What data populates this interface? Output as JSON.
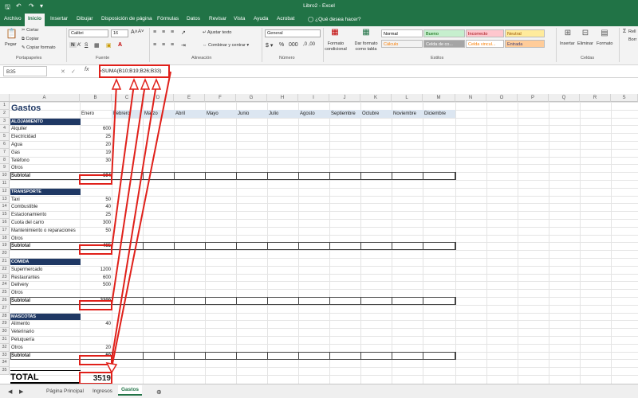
{
  "window": {
    "title": "Libro2 - Excel"
  },
  "ribbon_tabs": [
    "Archivo",
    "Inicio",
    "Insertar",
    "Dibujar",
    "Disposición de página",
    "Fórmulas",
    "Datos",
    "Revisar",
    "Vista",
    "Ayuda",
    "Acrobat"
  ],
  "active_tab": "Inicio",
  "tell_me": "¿Qué desea hacer?",
  "clipboard": {
    "paste": "Pegar",
    "cut": "Cortar",
    "copy": "Copiar",
    "format_painter": "Copiar formato",
    "label": "Portapapeles"
  },
  "font": {
    "name": "Calibri",
    "size": "16",
    "label": "Fuente",
    "bold": "N",
    "italic": "K",
    "underline": "S"
  },
  "alignment": {
    "wrap": "Ajustar texto",
    "merge": "Combinar y centrar",
    "label": "Alineación"
  },
  "number": {
    "format": "General",
    "label": "Número"
  },
  "styles": {
    "cond_format": "Formato condicional",
    "table_format": "Dar formato como tabla",
    "label": "Estilos",
    "cells": [
      {
        "text": "Normal",
        "bg": "#ffffff",
        "fg": "#000000"
      },
      {
        "text": "Bueno",
        "bg": "#c6efce",
        "fg": "#006100"
      },
      {
        "text": "Incorrecto",
        "bg": "#ffc7ce",
        "fg": "#9c0006"
      },
      {
        "text": "Neutral",
        "bg": "#ffeb9c",
        "fg": "#9c5700"
      },
      {
        "text": "Cálculo",
        "bg": "#f2f2f2",
        "fg": "#fa7d00"
      },
      {
        "text": "Celda de co...",
        "bg": "#a5a5a5",
        "fg": "#ffffff"
      },
      {
        "text": "Celda vincul...",
        "bg": "#ffffff",
        "fg": "#fa7d00"
      },
      {
        "text": "Entrada",
        "bg": "#ffcc99",
        "fg": "#3f3f76"
      }
    ]
  },
  "cells_group": {
    "insert": "Insertar",
    "delete": "Eliminar",
    "format": "Formato",
    "label": "Celdas"
  },
  "editing": {
    "sum": "Σ",
    "fill": "Rell",
    "clear": "Borr"
  },
  "name_box": "B35",
  "formula": "=SUMA(B10;B19;B26;B33)",
  "columns": [
    "A",
    "B",
    "C",
    "D",
    "E",
    "F",
    "G",
    "H",
    "I",
    "J",
    "K",
    "L",
    "M",
    "N",
    "O",
    "P",
    "Q",
    "R",
    "S"
  ],
  "months": [
    "Enero",
    "Febrero",
    "Marzo",
    "Abril",
    "Mayo",
    "Junio",
    "Julio",
    "Agosto",
    "Septiembre",
    "Octubre",
    "Noviembre",
    "Diciembre"
  ],
  "title": "Gastos",
  "sections": [
    {
      "header": "ALOJAMIENTO",
      "items": [
        [
          "Alquiler",
          "600"
        ],
        [
          "Electricidad",
          "25"
        ],
        [
          "Agua",
          "20"
        ],
        [
          "Gas",
          "19"
        ],
        [
          "Teléfono",
          "30"
        ],
        [
          "Otros",
          ""
        ]
      ],
      "subtotal_label": "Subtotal",
      "subtotal": "694"
    },
    {
      "header": "TRANSPORTE",
      "items": [
        [
          "Taxi",
          "50"
        ],
        [
          "Combustible",
          "40"
        ],
        [
          "Estacionamiento",
          "25"
        ],
        [
          "Cuota del carro",
          "300"
        ],
        [
          "Mantenimiento o reparaciones",
          "50"
        ],
        [
          "Otros",
          ""
        ]
      ],
      "subtotal_label": "Subtotal",
      "subtotal": "465"
    },
    {
      "header": "COMIDA",
      "items": [
        [
          "Supermercado",
          "1200"
        ],
        [
          "Restaurantes",
          "600"
        ],
        [
          "Delivery",
          "500"
        ],
        [
          "Otros",
          ""
        ]
      ],
      "subtotal_label": "Subtotal",
      "subtotal": "2300"
    },
    {
      "header": "MASCOTAS",
      "items": [
        [
          "Alimento",
          "40"
        ],
        [
          "Veterinario",
          ""
        ],
        [
          "Peluquería",
          ""
        ],
        [
          "Otros",
          "20"
        ]
      ],
      "subtotal_label": "Subtotal",
      "subtotal": "60"
    }
  ],
  "total_label": "TOTAL",
  "total_value": "3519",
  "sheet_tabs": [
    "Página Principal",
    "Ingresos",
    "Gastos"
  ],
  "active_sheet": "Gastos",
  "colors": {
    "excel_green": "#217346",
    "section_header": "#1f3864",
    "annotation_red": "#e0201a"
  }
}
